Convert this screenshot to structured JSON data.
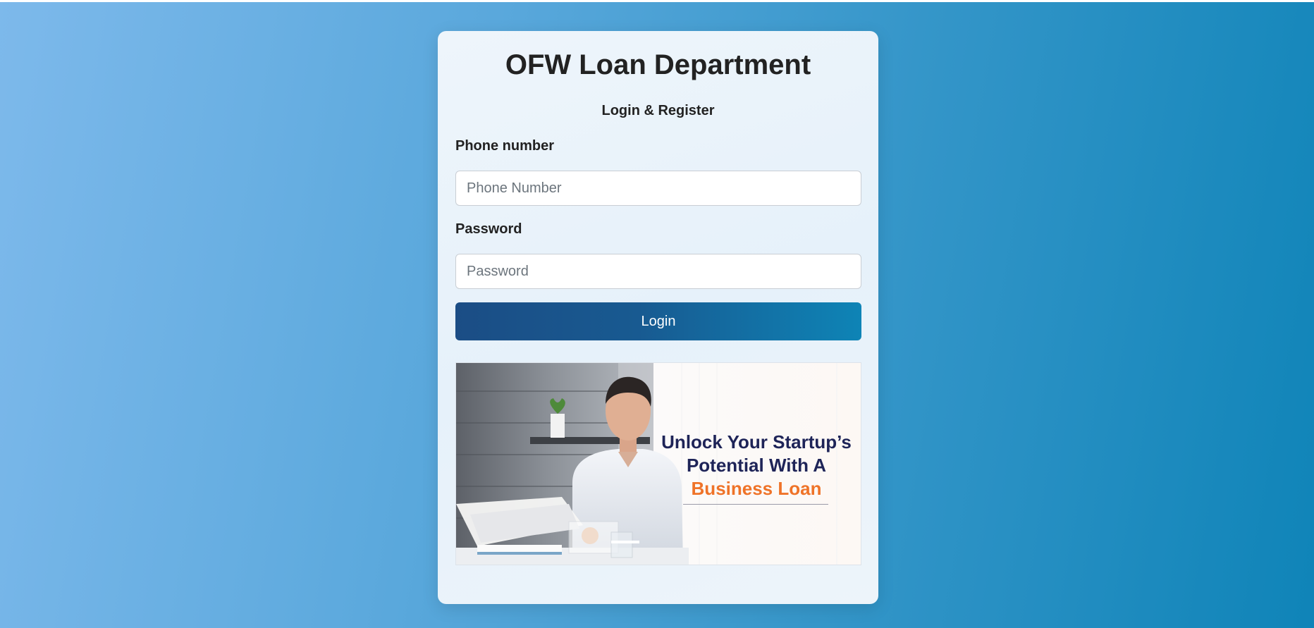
{
  "page": {
    "title": "OFW Loan Department",
    "subtitle": "Login & Register"
  },
  "form": {
    "phone_label": "Phone number",
    "phone_placeholder": "Phone Number",
    "phone_value": "",
    "password_label": "Password",
    "password_placeholder": "Password",
    "password_value": "",
    "login_label": "Login"
  },
  "banner": {
    "line1": "Unlock Your Startup’s",
    "line2": "Potential With A",
    "line3": "Business Loan",
    "colors": {
      "dark_text": "#1e2458",
      "accent_text": "#ef7328"
    }
  },
  "colors": {
    "button_start": "#1b4d85",
    "button_end": "#0e84b6",
    "background_start": "#7db9eb",
    "background_end": "#0f84b8"
  }
}
